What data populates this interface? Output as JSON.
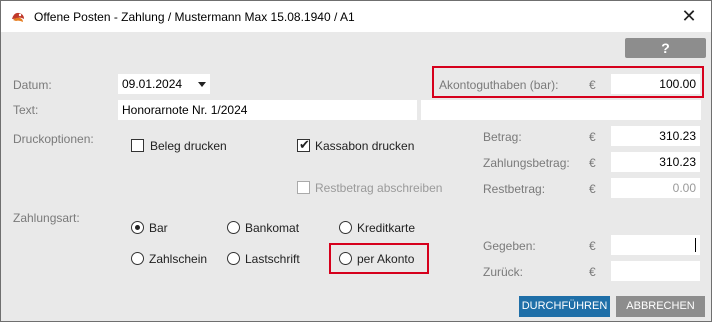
{
  "window": {
    "title": "Offene Posten - Zahlung / Mustermann Max 15.08.1940 / A1",
    "close_glyph": "✕"
  },
  "help": {
    "label": "?"
  },
  "form": {
    "datum_label": "Datum:",
    "datum_value": "09.01.2024",
    "text_label": "Text:",
    "text_value": "Honorarnote Nr. 1/2024",
    "akonto_label": "Akontoguthaben (bar):",
    "akonto_currency": "€",
    "akonto_value": "100.00",
    "druck_label": "Druckoptionen:",
    "beleg_label": "Beleg drucken",
    "beleg_checked": false,
    "kassabon_label": "Kassabon drucken",
    "kassabon_checked": true,
    "restbetrag_abschreiben_label": "Restbetrag abschreiben",
    "restbetrag_abschreiben_checked": false,
    "zahlungsart_label": "Zahlungsart:",
    "payment_options": {
      "bar": "Bar",
      "bankomat": "Bankomat",
      "kreditkarte": "Kreditkarte",
      "zahlschein": "Zahlschein",
      "lastschrift": "Lastschrift",
      "akonto": "per Akonto"
    },
    "selected_payment": "Bar"
  },
  "amounts": {
    "betrag_label": "Betrag:",
    "betrag_value": "310.23",
    "zahlungsbetrag_label": "Zahlungsbetrag:",
    "zahlungsbetrag_value": "310.23",
    "restbetrag_label": "Restbetrag:",
    "restbetrag_value": "0.00",
    "gegeben_label": "Gegeben:",
    "gegeben_value": "",
    "zurueck_label": "Zurück:",
    "zurueck_value": "",
    "currency": "€"
  },
  "footer": {
    "execute_label": "DURCHFÜHREN",
    "cancel_label": "ABBRECHEN"
  },
  "colors": {
    "primary_button": "#1f6fa8",
    "secondary_button": "#8d8d8d",
    "highlight_box": "#d6001c",
    "dialog_background": "#e9e9e9"
  }
}
